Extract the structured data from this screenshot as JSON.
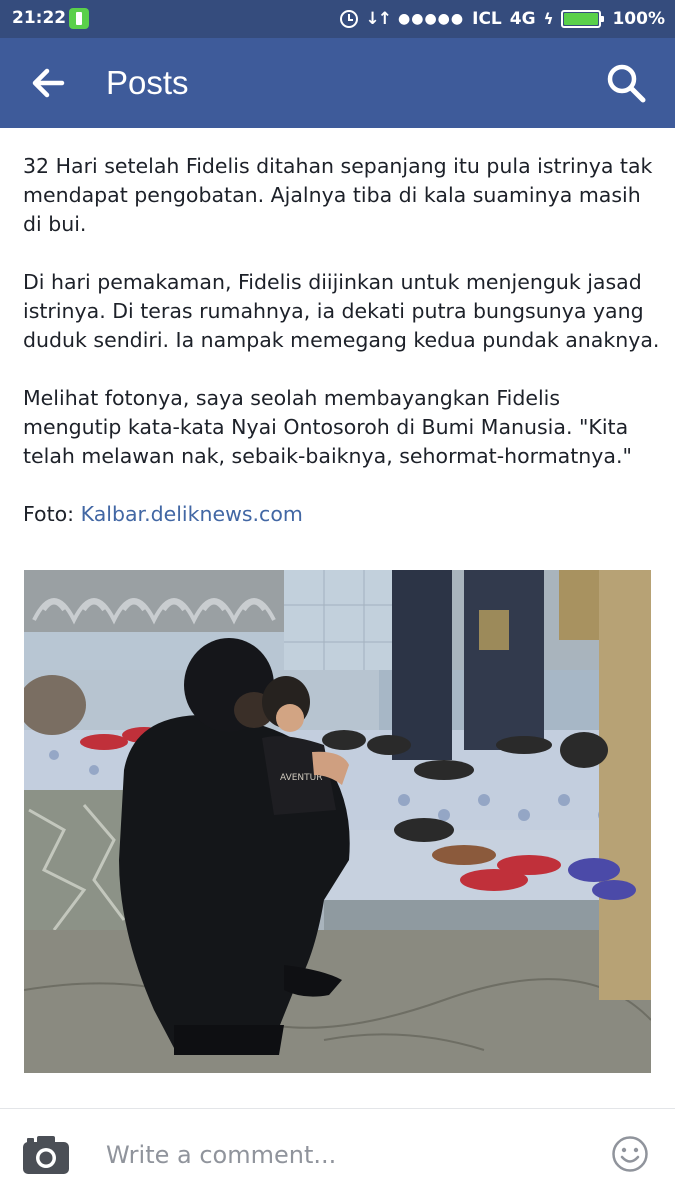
{
  "status_bar": {
    "time": "21:22",
    "data_icon": "↓↑",
    "signal_dots": "●●●●●",
    "carrier": "ICL",
    "network": "4G",
    "charging_icon": "ϟ",
    "battery_percent": "100%",
    "battery_level": 1.0,
    "background_color": "#354c7d"
  },
  "app_bar": {
    "title": "Posts",
    "back_icon": "arrow-left-icon",
    "search_icon": "search-icon",
    "background_color": "#3e5b9a"
  },
  "post": {
    "paragraphs": [
      "32 Hari setelah Fidelis ditahan sepanjang itu pula istrinya tak mendapat pengobatan. Ajalnya tiba di kala suaminya masih di bui.",
      "Di hari pemakaman, Fidelis diijinkan untuk menjenguk jasad istrinya. Di teras rumahnya, ia dekati putra bungsunya yang duduk sendiri. Ia nampak memegang kedua pundak anaknya.",
      "Melihat fotonya, saya seolah membayangkan Fidelis mengutip kata-kata Nyai Ontosoroh di Bumi Manusia. \"Kita telah melawan nak, sebaik-baiknya, sehormat-hormatnya.\""
    ],
    "credit_label": "Foto:",
    "credit_link": "Kalbar.deliknews.com",
    "link_color": "#4267a4",
    "photo_caption_text": "AVENTUR"
  },
  "comment_bar": {
    "placeholder": "Write a comment...",
    "camera_icon": "camera-icon",
    "emoji_icon": "smiley-icon"
  }
}
